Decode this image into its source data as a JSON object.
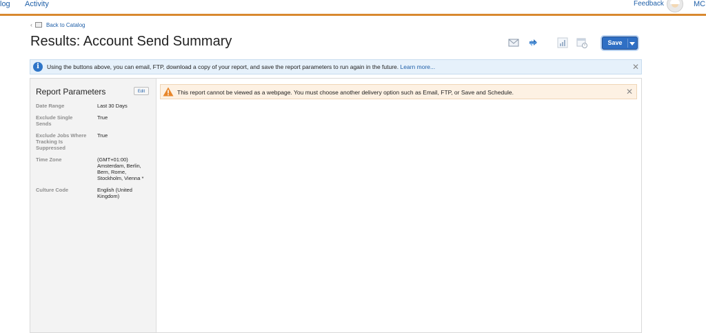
{
  "topnav": {
    "items": [
      "log",
      "Activity"
    ],
    "feedback": "Feedback",
    "user_short": "MCI"
  },
  "back_link": "Back to Catalog",
  "page_title": "Results: Account Send Summary",
  "toolbar": {
    "icons": [
      "email-icon",
      "ftp-icon",
      "download-icon",
      "schedule-icon"
    ],
    "save_label": "Save"
  },
  "info_banner": {
    "text": "Using the buttons above, you can email, FTP, download a copy of your report, and save the report parameters to run again in the future.",
    "link": "Learn more..."
  },
  "parameters": {
    "title": "Report Parameters",
    "edit_label": "Edit",
    "rows": [
      {
        "label": "Date Range",
        "value": "Last 30 Days"
      },
      {
        "label": "Exclude Single Sends",
        "value": "True"
      },
      {
        "label": "Exclude Jobs Where Tracking Is Suppressed",
        "value": "True"
      },
      {
        "label": "Time Zone",
        "value": "(GMT+01:00) Amsterdam, Berlin, Bern, Rome, Stockholm, Vienna *"
      },
      {
        "label": "Culture Code",
        "value": "English (United Kingdom)"
      }
    ]
  },
  "warning_banner": {
    "text": "This report cannot be viewed as a webpage. You must choose another delivery option such as Email, FTP, or Save and Schedule."
  },
  "colors": {
    "accent": "#d8892f",
    "link": "#1f5fa8",
    "primary_button": "#2f6fc4",
    "info_bg": "#e6f1fb",
    "warning_bg": "#fdf1e3",
    "warning_icon": "#e8862a"
  }
}
